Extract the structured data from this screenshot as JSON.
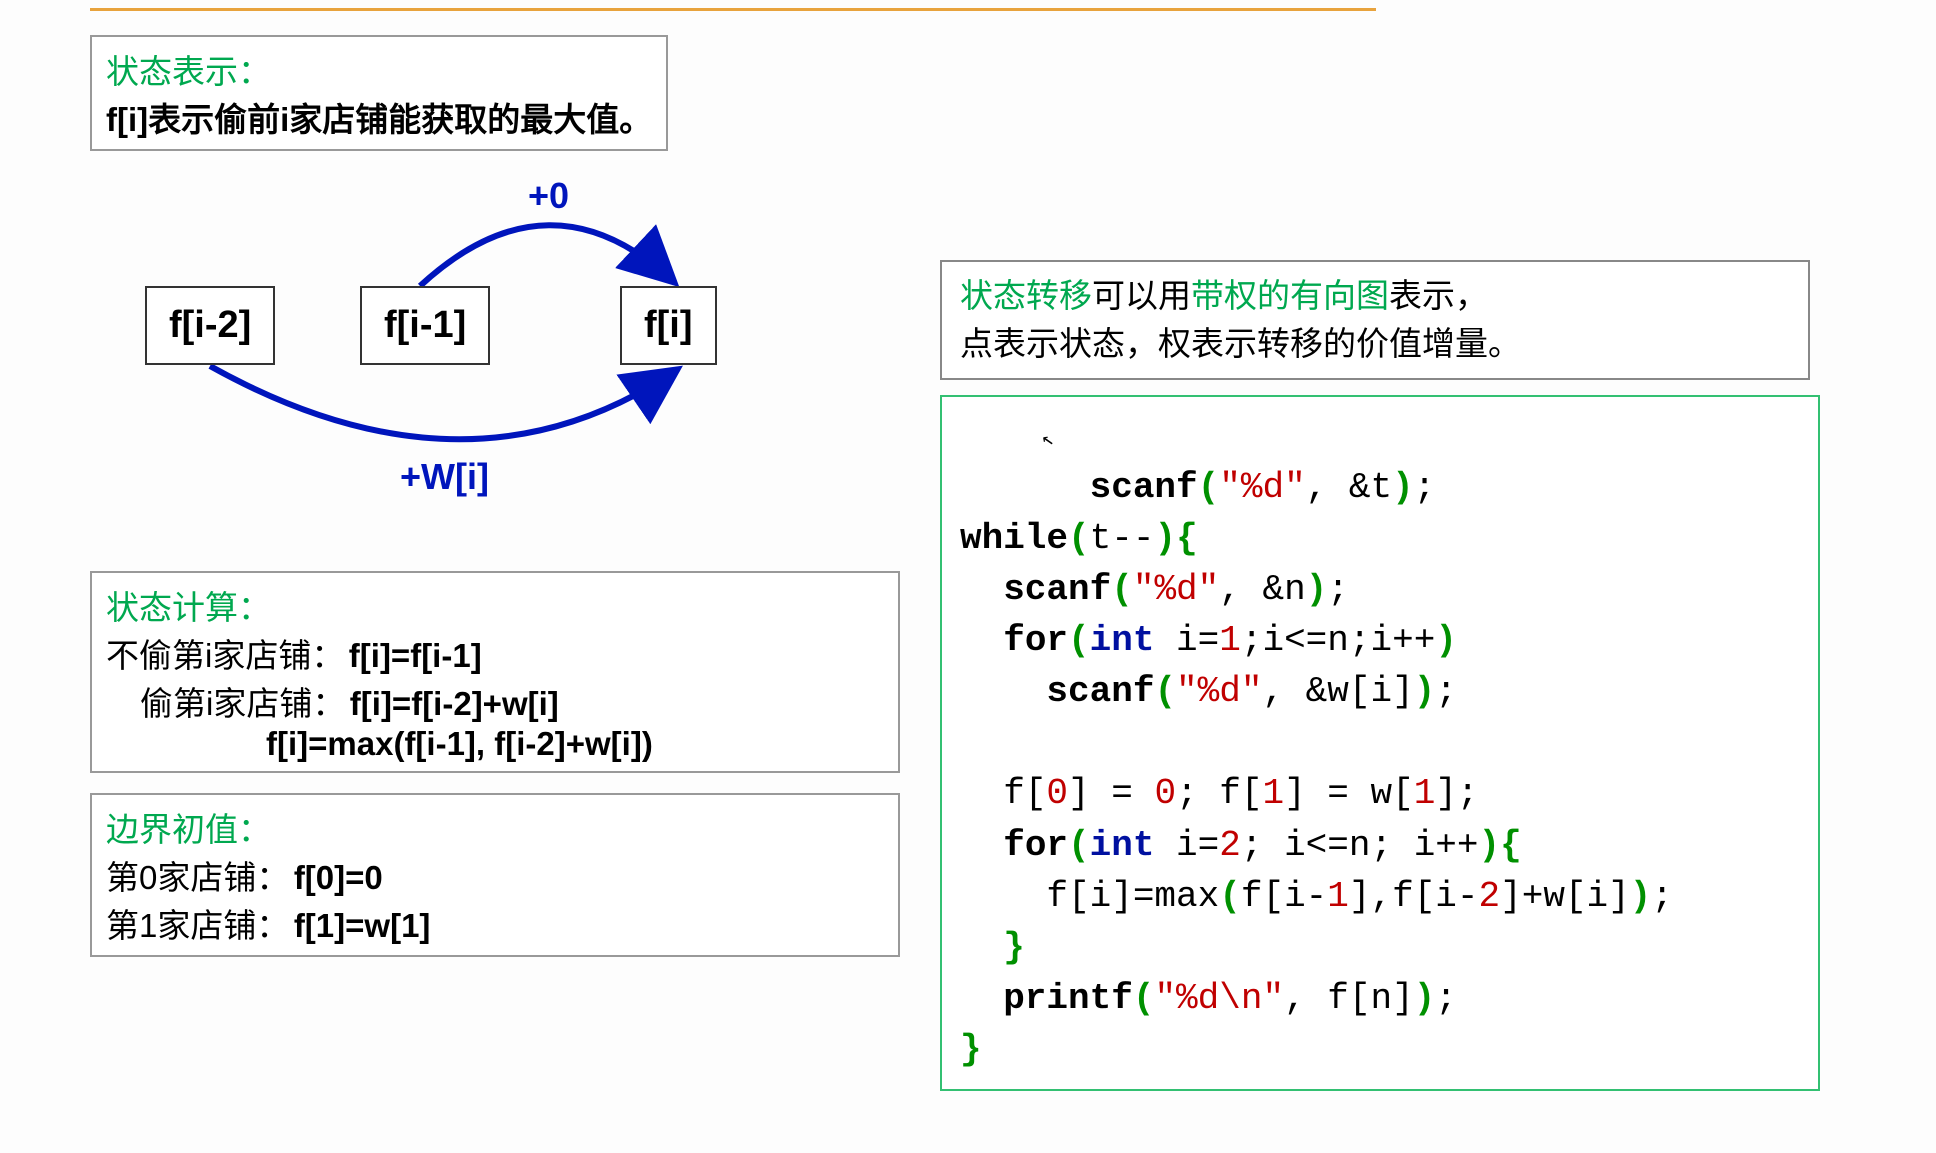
{
  "state_rep": {
    "title": "状态表示：",
    "body": "f[i]表示偷前i家店铺能获取的最大值。"
  },
  "diagram": {
    "nodes": {
      "n1": "f[i-2]",
      "n2": "f[i-1]",
      "n3": "f[i]"
    },
    "labels": {
      "top": "+0",
      "bottom": "+W[i]"
    }
  },
  "transfer": {
    "seg1": "状态转移",
    "seg2": "可以用",
    "seg3": "带权的有向图",
    "seg4": "表示，",
    "line2": "点表示状态，权表示转移的价值增量。"
  },
  "calc": {
    "title": "状态计算：",
    "line1a": "不偷第i家店铺：",
    "line1b": "f[i]=f[i-1]",
    "line2a": "偷第i家店铺：",
    "line2b": "f[i]=f[i-2]+w[i]",
    "line3": "f[i]=max(f[i-1], f[i-2]+w[i])"
  },
  "init": {
    "title": "边界初值：",
    "line1a": "第0家店铺：",
    "line1b": "f[0]=0",
    "line2a": "第1家店铺：",
    "line2b": "f[1]=w[1]"
  },
  "code": {
    "t1a": "scanf",
    "t1b": "(",
    "t1c": "\"%d\"",
    "t1d": ", &t",
    "t1e": ")",
    "t1f": ";",
    "t2a": "while",
    "t2b": "(",
    "t2c": "t--",
    "t2d": ")",
    "t2e": "{",
    "t3a": "  scanf",
    "t3b": "(",
    "t3c": "\"%d\"",
    "t3d": ", &n",
    "t3e": ")",
    "t3f": ";",
    "t4a": "  ",
    "t4b": "for",
    "t4c": "(",
    "t4d": "int",
    "t4e": " i=",
    "t4f": "1",
    "t4g": ";i<=n;i++",
    "t4h": ")",
    "t5a": "    scanf",
    "t5b": "(",
    "t5c": "\"%d\"",
    "t5d": ", &w[i]",
    "t5e": ")",
    "t5f": ";",
    "blank": "",
    "t6a": "  f[",
    "t6b": "0",
    "t6c": "] = ",
    "t6d": "0",
    "t6e": "; f[",
    "t6f": "1",
    "t6g": "] = w[",
    "t6h": "1",
    "t6i": "];",
    "t7a": "  ",
    "t7b": "for",
    "t7c": "(",
    "t7d": "int",
    "t7e": " i=",
    "t7f": "2",
    "t7g": "; i<=n; i++",
    "t7h": ")",
    "t7i": "{",
    "t8a": "    f[i]=max",
    "t8b": "(",
    "t8c": "f[i-",
    "t8d": "1",
    "t8e": "],f[i-",
    "t8f": "2",
    "t8g": "]+w[i]",
    "t8h": ")",
    "t8i": ";",
    "t9": "  }",
    "t10a": "  printf",
    "t10b": "(",
    "t10c": "\"%d\\n\"",
    "t10d": ", f[n]",
    "t10e": ")",
    "t10f": ";",
    "t11": "}"
  }
}
